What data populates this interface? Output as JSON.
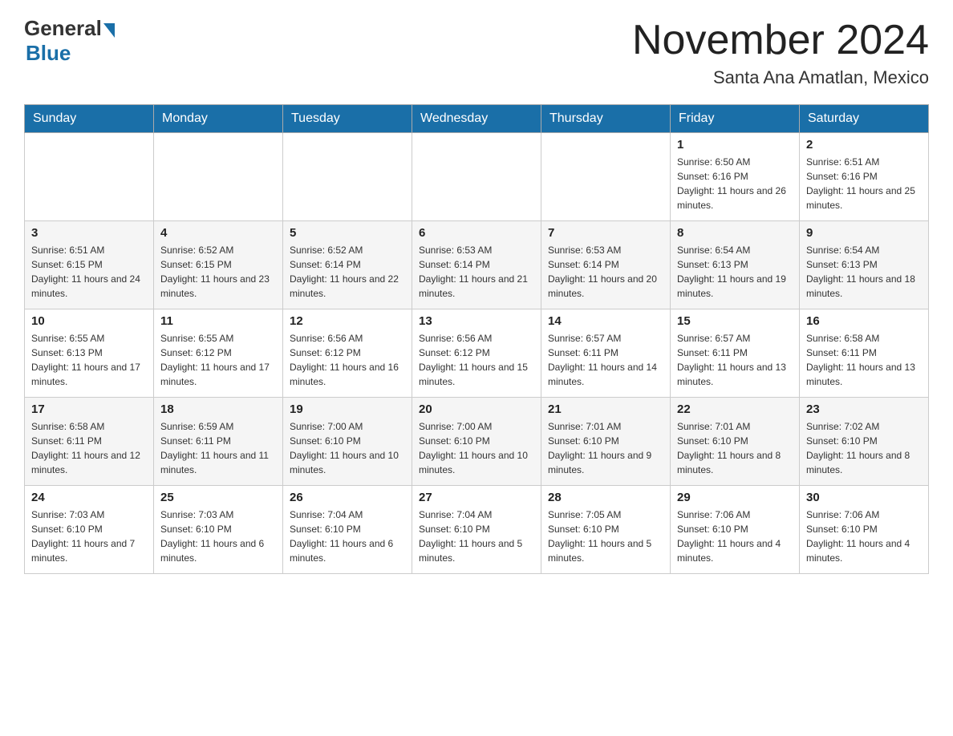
{
  "header": {
    "logo_general": "General",
    "logo_blue": "Blue",
    "month_title": "November 2024",
    "location": "Santa Ana Amatlan, Mexico"
  },
  "weekdays": [
    "Sunday",
    "Monday",
    "Tuesday",
    "Wednesday",
    "Thursday",
    "Friday",
    "Saturday"
  ],
  "weeks": [
    [
      {
        "day": "",
        "sunrise": "",
        "sunset": "",
        "daylight": ""
      },
      {
        "day": "",
        "sunrise": "",
        "sunset": "",
        "daylight": ""
      },
      {
        "day": "",
        "sunrise": "",
        "sunset": "",
        "daylight": ""
      },
      {
        "day": "",
        "sunrise": "",
        "sunset": "",
        "daylight": ""
      },
      {
        "day": "",
        "sunrise": "",
        "sunset": "",
        "daylight": ""
      },
      {
        "day": "1",
        "sunrise": "Sunrise: 6:50 AM",
        "sunset": "Sunset: 6:16 PM",
        "daylight": "Daylight: 11 hours and 26 minutes."
      },
      {
        "day": "2",
        "sunrise": "Sunrise: 6:51 AM",
        "sunset": "Sunset: 6:16 PM",
        "daylight": "Daylight: 11 hours and 25 minutes."
      }
    ],
    [
      {
        "day": "3",
        "sunrise": "Sunrise: 6:51 AM",
        "sunset": "Sunset: 6:15 PM",
        "daylight": "Daylight: 11 hours and 24 minutes."
      },
      {
        "day": "4",
        "sunrise": "Sunrise: 6:52 AM",
        "sunset": "Sunset: 6:15 PM",
        "daylight": "Daylight: 11 hours and 23 minutes."
      },
      {
        "day": "5",
        "sunrise": "Sunrise: 6:52 AM",
        "sunset": "Sunset: 6:14 PM",
        "daylight": "Daylight: 11 hours and 22 minutes."
      },
      {
        "day": "6",
        "sunrise": "Sunrise: 6:53 AM",
        "sunset": "Sunset: 6:14 PM",
        "daylight": "Daylight: 11 hours and 21 minutes."
      },
      {
        "day": "7",
        "sunrise": "Sunrise: 6:53 AM",
        "sunset": "Sunset: 6:14 PM",
        "daylight": "Daylight: 11 hours and 20 minutes."
      },
      {
        "day": "8",
        "sunrise": "Sunrise: 6:54 AM",
        "sunset": "Sunset: 6:13 PM",
        "daylight": "Daylight: 11 hours and 19 minutes."
      },
      {
        "day": "9",
        "sunrise": "Sunrise: 6:54 AM",
        "sunset": "Sunset: 6:13 PM",
        "daylight": "Daylight: 11 hours and 18 minutes."
      }
    ],
    [
      {
        "day": "10",
        "sunrise": "Sunrise: 6:55 AM",
        "sunset": "Sunset: 6:13 PM",
        "daylight": "Daylight: 11 hours and 17 minutes."
      },
      {
        "day": "11",
        "sunrise": "Sunrise: 6:55 AM",
        "sunset": "Sunset: 6:12 PM",
        "daylight": "Daylight: 11 hours and 17 minutes."
      },
      {
        "day": "12",
        "sunrise": "Sunrise: 6:56 AM",
        "sunset": "Sunset: 6:12 PM",
        "daylight": "Daylight: 11 hours and 16 minutes."
      },
      {
        "day": "13",
        "sunrise": "Sunrise: 6:56 AM",
        "sunset": "Sunset: 6:12 PM",
        "daylight": "Daylight: 11 hours and 15 minutes."
      },
      {
        "day": "14",
        "sunrise": "Sunrise: 6:57 AM",
        "sunset": "Sunset: 6:11 PM",
        "daylight": "Daylight: 11 hours and 14 minutes."
      },
      {
        "day": "15",
        "sunrise": "Sunrise: 6:57 AM",
        "sunset": "Sunset: 6:11 PM",
        "daylight": "Daylight: 11 hours and 13 minutes."
      },
      {
        "day": "16",
        "sunrise": "Sunrise: 6:58 AM",
        "sunset": "Sunset: 6:11 PM",
        "daylight": "Daylight: 11 hours and 13 minutes."
      }
    ],
    [
      {
        "day": "17",
        "sunrise": "Sunrise: 6:58 AM",
        "sunset": "Sunset: 6:11 PM",
        "daylight": "Daylight: 11 hours and 12 minutes."
      },
      {
        "day": "18",
        "sunrise": "Sunrise: 6:59 AM",
        "sunset": "Sunset: 6:11 PM",
        "daylight": "Daylight: 11 hours and 11 minutes."
      },
      {
        "day": "19",
        "sunrise": "Sunrise: 7:00 AM",
        "sunset": "Sunset: 6:10 PM",
        "daylight": "Daylight: 11 hours and 10 minutes."
      },
      {
        "day": "20",
        "sunrise": "Sunrise: 7:00 AM",
        "sunset": "Sunset: 6:10 PM",
        "daylight": "Daylight: 11 hours and 10 minutes."
      },
      {
        "day": "21",
        "sunrise": "Sunrise: 7:01 AM",
        "sunset": "Sunset: 6:10 PM",
        "daylight": "Daylight: 11 hours and 9 minutes."
      },
      {
        "day": "22",
        "sunrise": "Sunrise: 7:01 AM",
        "sunset": "Sunset: 6:10 PM",
        "daylight": "Daylight: 11 hours and 8 minutes."
      },
      {
        "day": "23",
        "sunrise": "Sunrise: 7:02 AM",
        "sunset": "Sunset: 6:10 PM",
        "daylight": "Daylight: 11 hours and 8 minutes."
      }
    ],
    [
      {
        "day": "24",
        "sunrise": "Sunrise: 7:03 AM",
        "sunset": "Sunset: 6:10 PM",
        "daylight": "Daylight: 11 hours and 7 minutes."
      },
      {
        "day": "25",
        "sunrise": "Sunrise: 7:03 AM",
        "sunset": "Sunset: 6:10 PM",
        "daylight": "Daylight: 11 hours and 6 minutes."
      },
      {
        "day": "26",
        "sunrise": "Sunrise: 7:04 AM",
        "sunset": "Sunset: 6:10 PM",
        "daylight": "Daylight: 11 hours and 6 minutes."
      },
      {
        "day": "27",
        "sunrise": "Sunrise: 7:04 AM",
        "sunset": "Sunset: 6:10 PM",
        "daylight": "Daylight: 11 hours and 5 minutes."
      },
      {
        "day": "28",
        "sunrise": "Sunrise: 7:05 AM",
        "sunset": "Sunset: 6:10 PM",
        "daylight": "Daylight: 11 hours and 5 minutes."
      },
      {
        "day": "29",
        "sunrise": "Sunrise: 7:06 AM",
        "sunset": "Sunset: 6:10 PM",
        "daylight": "Daylight: 11 hours and 4 minutes."
      },
      {
        "day": "30",
        "sunrise": "Sunrise: 7:06 AM",
        "sunset": "Sunset: 6:10 PM",
        "daylight": "Daylight: 11 hours and 4 minutes."
      }
    ]
  ]
}
